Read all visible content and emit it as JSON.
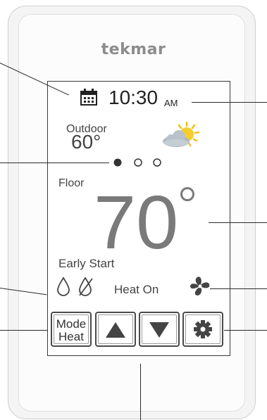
{
  "brand": "tekmar",
  "clock": {
    "time": "10:30",
    "period": "AM"
  },
  "outdoor": {
    "label": "Outdoor",
    "temperature": "60°"
  },
  "weather_icon": "partly-cloudy-icon",
  "page_indicator": {
    "count": 3,
    "active": 1
  },
  "floor": {
    "label": "Floor",
    "temperature": "70"
  },
  "status": {
    "early_start": "Early Start",
    "heat_on": "Heat On"
  },
  "buttons": {
    "mode_line1": "Mode",
    "mode_line2": "Heat",
    "up_icon": "up-arrow-icon",
    "down_icon": "down-arrow-icon",
    "settings_icon": "gear-icon"
  },
  "colors": {
    "brand": "#8c8c8c",
    "large_temperature": "#7a7a7a",
    "sun": "#f2c01a",
    "cloud": "#b9c2cb"
  }
}
